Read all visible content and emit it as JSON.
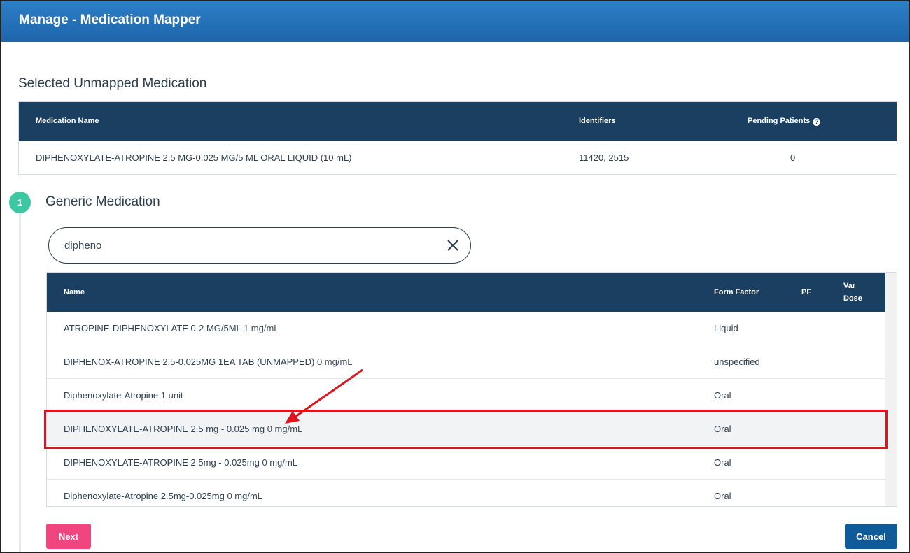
{
  "header": {
    "title": "Manage - Medication Mapper"
  },
  "selected": {
    "title": "Selected Unmapped Medication",
    "columns": {
      "name": "Medication Name",
      "identifiers": "Identifiers",
      "pending": "Pending Patients"
    },
    "row": {
      "name": "DIPHENOXYLATE-ATROPINE 2.5 MG-0.025 MG/5 ML ORAL LIQUID (10 mL)",
      "identifiers": "11420, 2515",
      "pending": "0"
    }
  },
  "step": {
    "number": "1",
    "title": "Generic Medication"
  },
  "search": {
    "value": "dipheno"
  },
  "generic": {
    "columns": {
      "name": "Name",
      "form_factor": "Form Factor",
      "pf": "PF",
      "var_dose_1": "Var",
      "var_dose_2": "Dose"
    },
    "rows": [
      {
        "name": "ATROPINE-DIPHENOXYLATE 0-2 MG/5ML",
        "dose": "1 mg/mL",
        "form": "Liquid"
      },
      {
        "name": "DIPHENOX-ATROPINE 2.5-0.025MG 1EA TAB (UNMAPPED)",
        "dose": "0 mg/mL",
        "form": "unspecified"
      },
      {
        "name": "Diphenoxylate-Atropine",
        "dose": "1 unit",
        "form": "Oral"
      },
      {
        "name": "DIPHENOXYLATE-ATROPINE 2.5 mg - 0.025 mg",
        "dose": "0 mg/mL",
        "form": "Oral"
      },
      {
        "name": "DIPHENOXYLATE-ATROPINE 2.5mg - 0.025mg",
        "dose": "0 mg/mL",
        "form": "Oral"
      },
      {
        "name": "Diphenoxylate-Atropine 2.5mg-0.025mg",
        "dose": "0 mg/mL",
        "form": "Oral"
      }
    ]
  },
  "buttons": {
    "next": "Next",
    "cancel": "Cancel"
  },
  "colors": {
    "header": "#1d65ab",
    "table_head": "#1b3f60",
    "step": "#3fc7a3",
    "next": "#f0457e",
    "cancel": "#0f5b9a",
    "annotation": "#e0141e"
  }
}
